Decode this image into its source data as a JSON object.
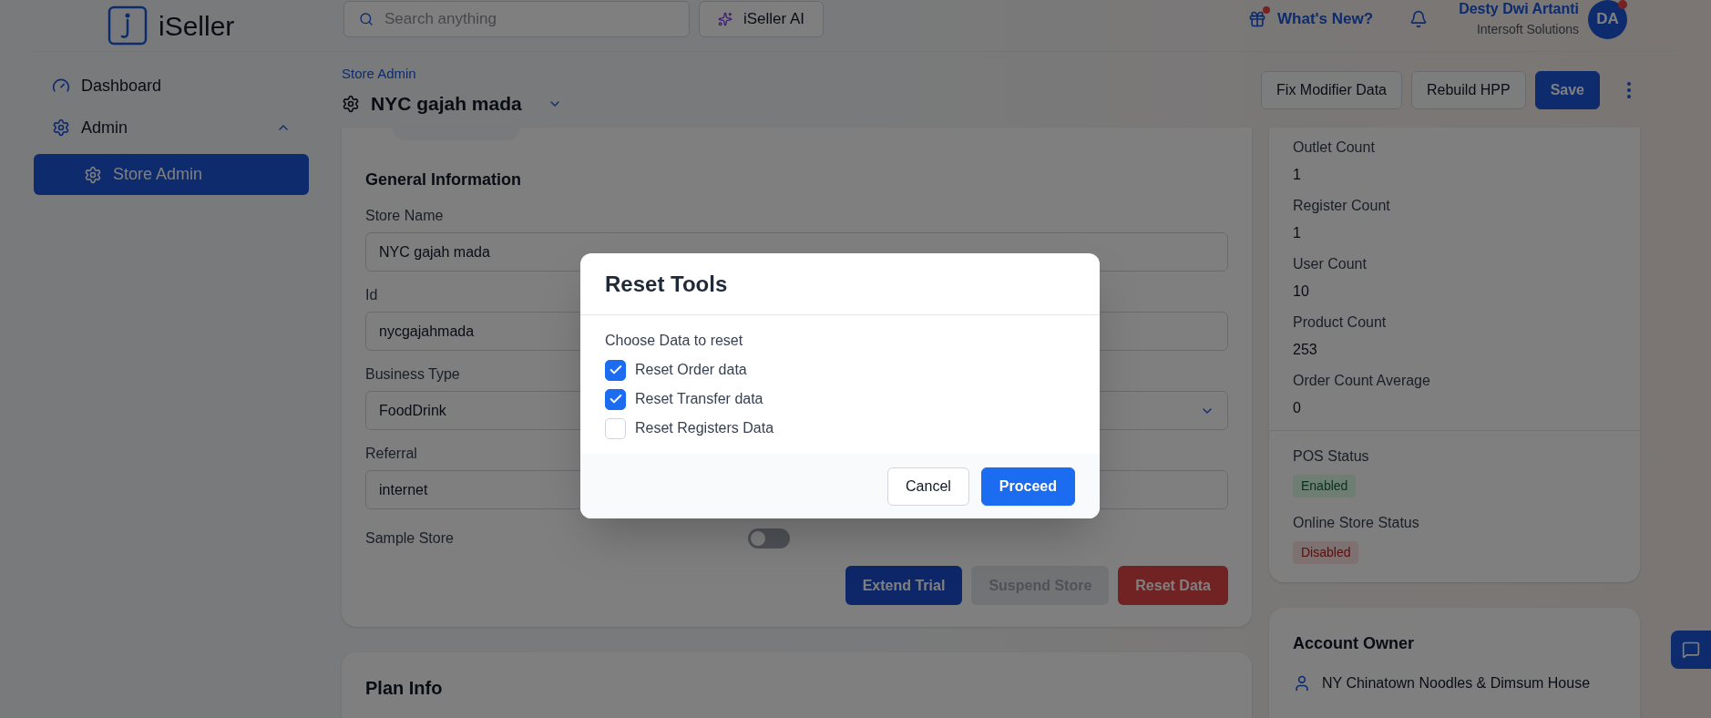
{
  "brand": {
    "name": "iSeller"
  },
  "search": {
    "placeholder": "Search anything"
  },
  "ai_button": {
    "label": "iSeller AI"
  },
  "whats_new": {
    "label": "What's New?",
    "unread": true
  },
  "user": {
    "name": "Desty Dwi Artanti",
    "company": "Intersoft Solutions",
    "initials": "DA",
    "unread": true
  },
  "sidebar": {
    "items": [
      {
        "label": "Dashboard",
        "kind": "dashboard",
        "selected": false
      },
      {
        "label": "Admin",
        "kind": "gear",
        "selected": false,
        "expanded": true,
        "children": [
          {
            "label": "Store Admin",
            "selected": true
          }
        ]
      }
    ]
  },
  "page": {
    "breadcrumb": "Store Admin",
    "title": "NYC gajah mada",
    "actions": [
      {
        "label": "Fix Modifier Data",
        "kind": "secondary"
      },
      {
        "label": "Rebuild HPP",
        "kind": "secondary"
      },
      {
        "label": "Save",
        "kind": "primary"
      }
    ]
  },
  "general": {
    "title": "General Information",
    "fields": [
      {
        "label": "Store Name",
        "value": "NYC gajah mada",
        "kind": "text"
      },
      {
        "label": "Id",
        "value": "nycgajahmada",
        "kind": "text"
      },
      {
        "label": "Business Type",
        "value": "FoodDrink",
        "kind": "select"
      },
      {
        "label": "Referral",
        "value": "internet",
        "kind": "text"
      }
    ],
    "sample_store": {
      "label": "Sample Store",
      "on": false
    },
    "buttons": [
      {
        "label": "Extend Trial",
        "kind": "primary"
      },
      {
        "label": "Suspend Store",
        "kind": "disabled"
      },
      {
        "label": "Reset Data",
        "kind": "danger"
      }
    ]
  },
  "plan": {
    "title": "Plan Info"
  },
  "stats": [
    {
      "label": "Outlet Count",
      "value": "1"
    },
    {
      "label": "Register Count",
      "value": "1"
    },
    {
      "label": "User Count",
      "value": "10"
    },
    {
      "label": "Product Count",
      "value": "253"
    },
    {
      "label": "Order Count Average",
      "value": "0"
    }
  ],
  "statuses": [
    {
      "label": "POS Status",
      "value": "Enabled",
      "kind": "enabled"
    },
    {
      "label": "Online Store Status",
      "value": "Disabled",
      "kind": "disabled"
    }
  ],
  "account_owner": {
    "title": "Account Owner",
    "name": "NY Chinatown Noodles & Dimsum House"
  },
  "dialog": {
    "title": "Reset Tools",
    "prompt": "Choose Data to reset",
    "options": [
      {
        "label": "Reset Order data",
        "checked": true
      },
      {
        "label": "Reset Transfer data",
        "checked": true
      },
      {
        "label": "Reset Registers Data",
        "checked": false
      }
    ],
    "buttons": [
      {
        "label": "Cancel",
        "kind": "secondary"
      },
      {
        "label": "Proceed",
        "kind": "primary"
      }
    ]
  }
}
